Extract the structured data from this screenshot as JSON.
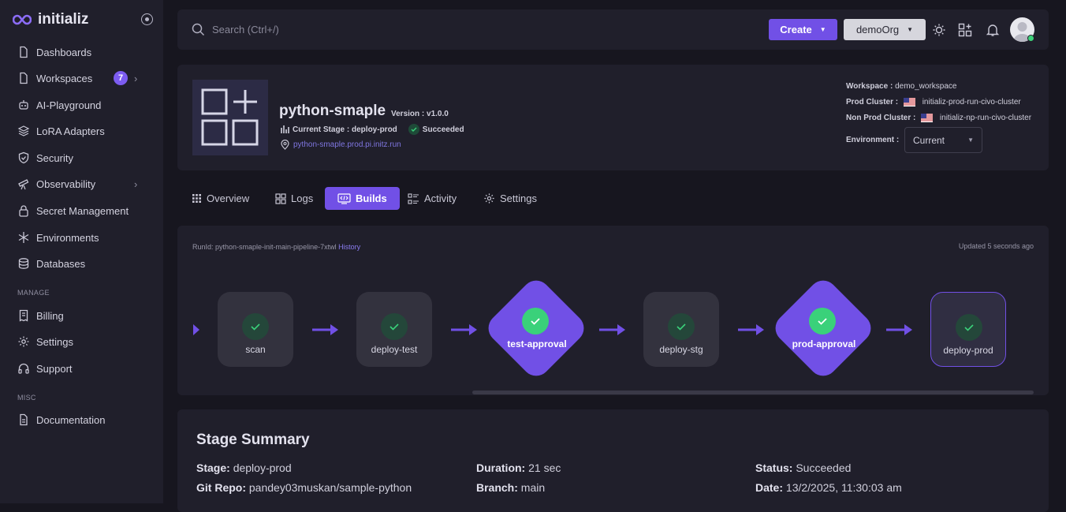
{
  "app": {
    "name": "initializ"
  },
  "sidebar": {
    "items": [
      {
        "label": "Dashboards"
      },
      {
        "label": "Workspaces",
        "badge": "7"
      },
      {
        "label": "AI-Playground"
      },
      {
        "label": "LoRA Adapters"
      },
      {
        "label": "Security"
      },
      {
        "label": "Observability"
      },
      {
        "label": "Secret Management"
      },
      {
        "label": "Environments"
      },
      {
        "label": "Databases"
      }
    ],
    "manage_label": "MANAGE",
    "manage_items": [
      {
        "label": "Billing"
      },
      {
        "label": "Settings"
      },
      {
        "label": "Support"
      }
    ],
    "misc_label": "MISC",
    "misc_items": [
      {
        "label": "Documentation"
      }
    ]
  },
  "topbar": {
    "search_placeholder": "Search (Ctrl+/)",
    "create_label": "Create",
    "org_label": "demoOrg"
  },
  "app_header": {
    "title": "python-smaple",
    "version": "Version : v1.0.0",
    "current_stage": "Current Stage : deploy-prod",
    "status": "Succeeded",
    "url": "python-smaple.prod.pi.initz.run",
    "workspace_label": "Workspace :",
    "workspace": "demo_workspace",
    "prod_cluster_label": "Prod Cluster :",
    "prod_cluster": "initializ-prod-run-civo-cluster",
    "nonprod_cluster_label": "Non Prod Cluster :",
    "nonprod_cluster": "initializ-np-run-civo-cluster",
    "environment_label": "Environment :",
    "environment": "Current"
  },
  "tabs": [
    {
      "label": "Overview"
    },
    {
      "label": "Logs"
    },
    {
      "label": "Builds",
      "active": true
    },
    {
      "label": "Activity"
    },
    {
      "label": "Settings"
    }
  ],
  "pipeline": {
    "runid_label": "RunId: python-smaple-init-main-pipeline-7xtwl",
    "history_label": "History",
    "updated": "Updated 5 seconds ago",
    "stages": [
      {
        "name": "scan",
        "kind": "job"
      },
      {
        "name": "deploy-test",
        "kind": "job"
      },
      {
        "name": "test-approval",
        "kind": "approval"
      },
      {
        "name": "deploy-stg",
        "kind": "job"
      },
      {
        "name": "prod-approval",
        "kind": "approval"
      },
      {
        "name": "deploy-prod",
        "kind": "job",
        "selected": true
      }
    ]
  },
  "summary": {
    "title": "Stage Summary",
    "stage_label": "Stage:",
    "stage": "deploy-prod",
    "duration_label": "Duration:",
    "duration": "21 sec",
    "status_label": "Status:",
    "status": "Succeeded",
    "repo_label": "Git Repo:",
    "repo": "pandey03muskan/sample-python",
    "branch_label": "Branch:",
    "branch": "main",
    "date_label": "Date:",
    "date": "13/2/2025, 11:30:03 am"
  },
  "colors": {
    "accent": "#7150e6",
    "success": "#3ad17a",
    "background": "#17161f",
    "panel": "#201f2b"
  }
}
